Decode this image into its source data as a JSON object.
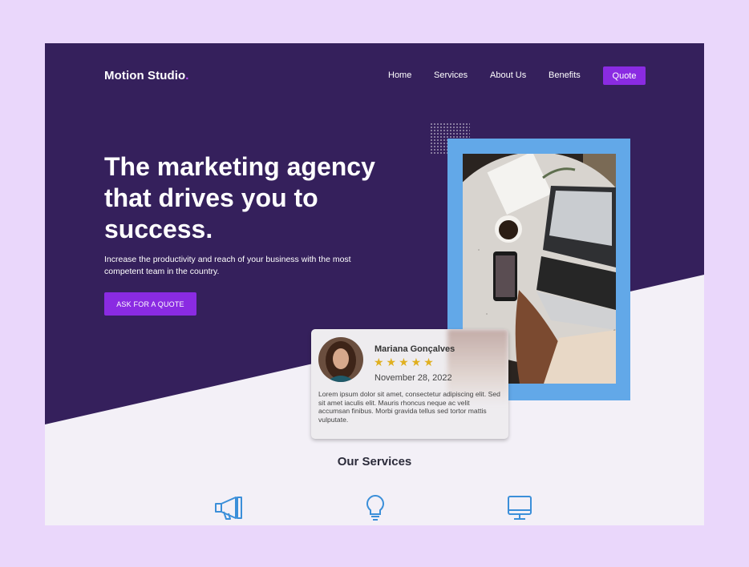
{
  "brand": {
    "name": "Motion Studio",
    "dot": "."
  },
  "nav": {
    "items": [
      "Home",
      "Services",
      "About Us",
      "Benefits"
    ],
    "quote": "Quote"
  },
  "hero": {
    "headline": "The marketing agency that drives you to success.",
    "subtext": "Increase the productivity and reach of your business with the most competent team in the country.",
    "cta": "ASK FOR A  QUOTE"
  },
  "review": {
    "name": "Mariana Gonçalves",
    "stars": "★★★★★",
    "rating": 5,
    "date": "November 28, 2022",
    "body": "Lorem ipsum dolor sit amet, consectetur adipiscing elit. Sed sit amet iaculis elit. Mauris rhoncus neque ac velit accumsan finibus. Morbi gravida tellus sed tortor mattis vulputate."
  },
  "services": {
    "title": "Our Services",
    "icons": [
      "megaphone-icon",
      "lightbulb-icon",
      "monitor-icon"
    ]
  },
  "colors": {
    "hero": "#35205c",
    "accent": "#8a2be2",
    "frame": "#62a8e8",
    "icon": "#3b8fd9",
    "page": "#ead7fb"
  }
}
